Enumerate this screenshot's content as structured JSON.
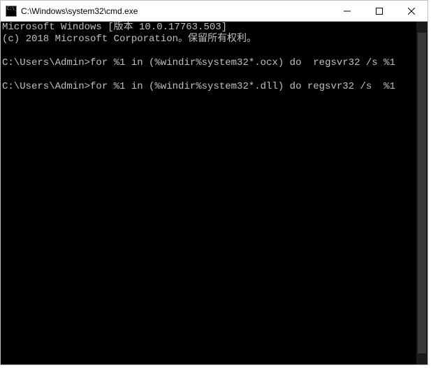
{
  "window": {
    "title": "C:\\Windows\\system32\\cmd.exe"
  },
  "terminal": {
    "lines": [
      "Microsoft Windows [版本 10.0.17763.503]",
      "(c) 2018 Microsoft Corporation。保留所有权利。",
      "",
      "C:\\Users\\Admin>for %1 in (%windir%system32*.ocx) do  regsvr32 /s %1",
      "",
      "C:\\Users\\Admin>for %1 in (%windir%system32*.dll) do regsvr32 /s  %1",
      ""
    ]
  },
  "controls": {
    "minimize": "minimize",
    "maximize": "maximize",
    "close": "close"
  }
}
